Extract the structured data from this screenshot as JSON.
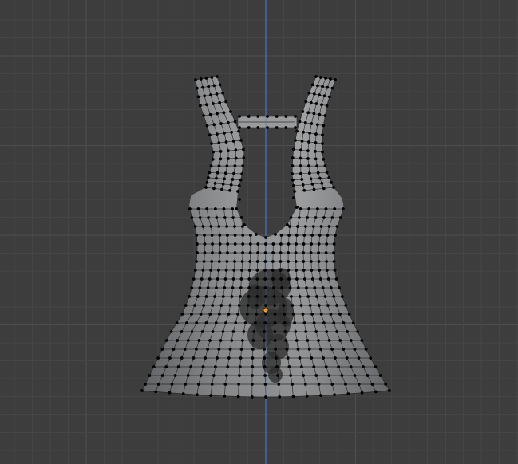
{
  "viewport": {
    "background_color": "#3d3d3d",
    "grid_minor_color": "#454545",
    "grid_major_color": "#4e4e4e",
    "axis_z_color": "#4a72b4",
    "mesh_fill_color": "#8e8f91",
    "mesh_edge_color": "#1e1e1e",
    "vertex_color": "#000000",
    "origin_color": "#f29a25",
    "texture_shadow_color": "#2e2e2e"
  },
  "object": {
    "type_icon": "mesh-icon",
    "shading_mode": "solid",
    "edit_mode": "vertex-select"
  }
}
